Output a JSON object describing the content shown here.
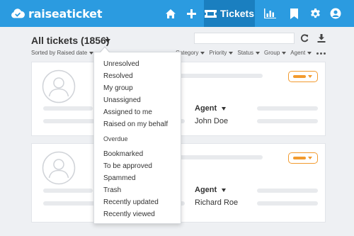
{
  "app": {
    "name": "raiseaticket"
  },
  "nav": {
    "active_label": "Tickets"
  },
  "header": {
    "title": "All tickets (1856)"
  },
  "filters": {
    "sort_label": "Sorted by Raised date",
    "columns": [
      "Category",
      "Priority",
      "Status",
      "Group",
      "Agent"
    ]
  },
  "tickets": [
    {
      "agent_label": "Agent",
      "agent_name": "John Doe"
    },
    {
      "agent_label": "Agent",
      "agent_name": "Richard Roe"
    }
  ],
  "dropdown": {
    "items": [
      "Unresolved",
      "Resolved",
      "My group",
      "Unassigned",
      "Assigned to me",
      "Raised on my behalf"
    ],
    "heading": "Overdue",
    "items2": [
      "Bookmarked",
      "To be approved",
      "Spammed",
      "Trash",
      "Recently updated",
      "Recently viewed"
    ]
  },
  "colors": {
    "header_bg": "#2b9be0",
    "header_active": "#1a7fc0",
    "accent_orange": "#f29a2e"
  }
}
